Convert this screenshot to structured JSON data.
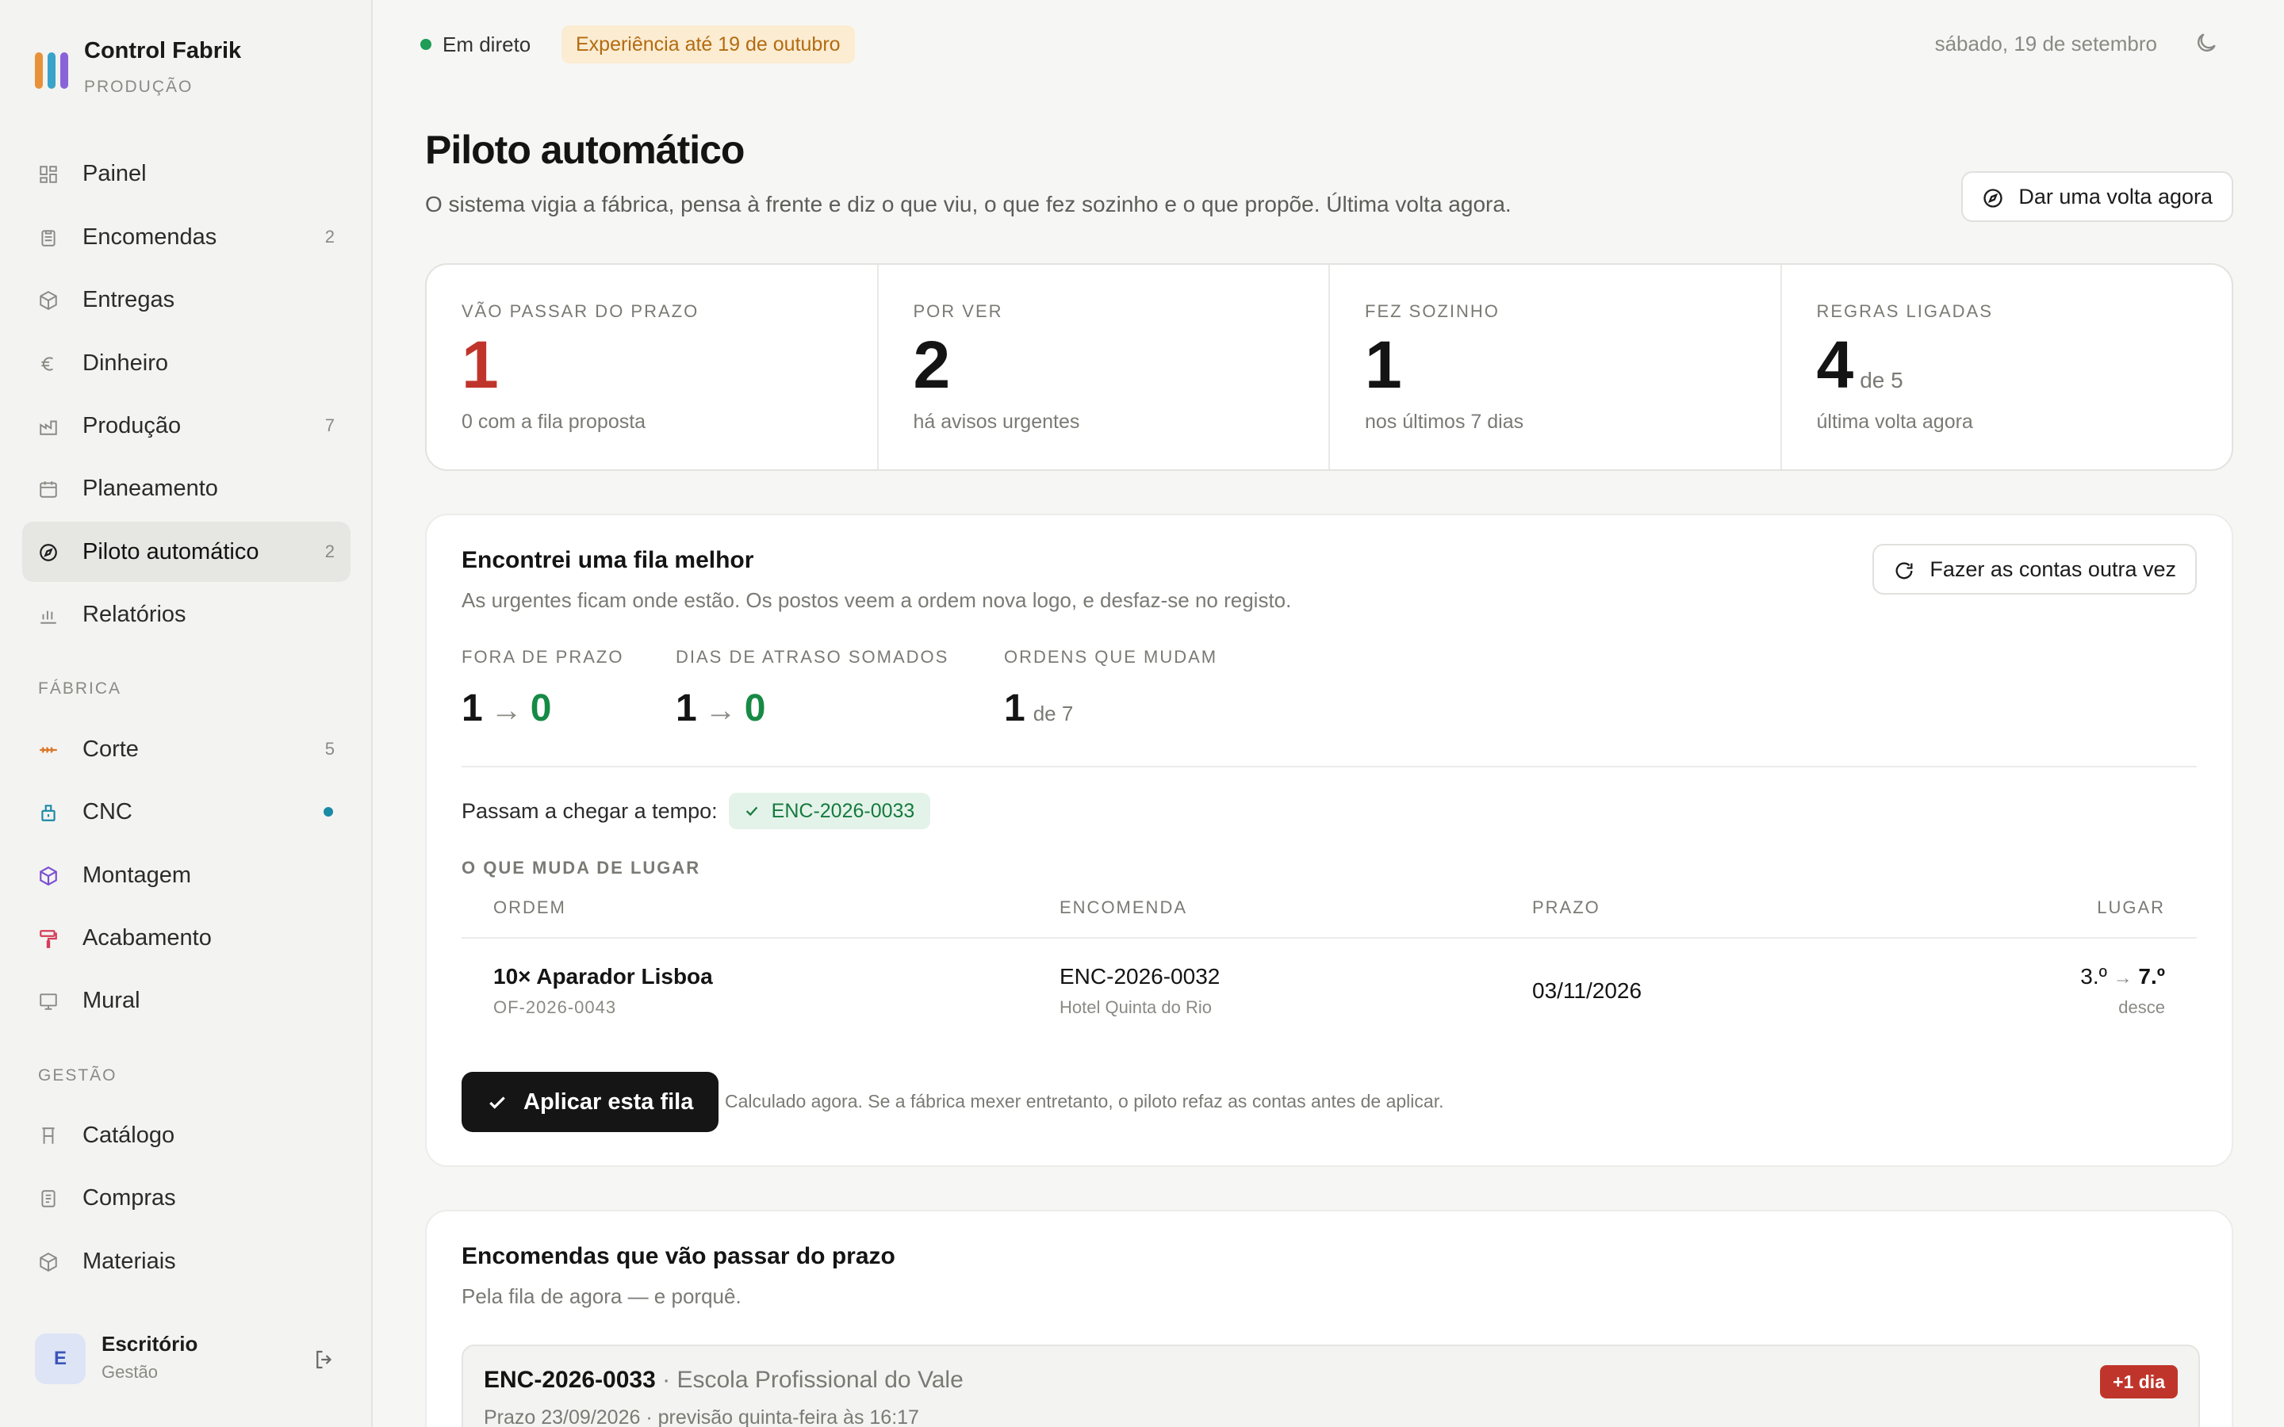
{
  "brand": {
    "name": "Control Fabrik",
    "env": "PRODUÇÃO",
    "colors": [
      "#e8913a",
      "#3aa3c9",
      "#8b63d9"
    ]
  },
  "nav": {
    "main": [
      {
        "label": "Painel",
        "icon": "dashboard-icon",
        "count": ""
      },
      {
        "label": "Encomendas",
        "icon": "clipboard-icon",
        "count": "2"
      },
      {
        "label": "Entregas",
        "icon": "box-icon",
        "count": ""
      },
      {
        "label": "Dinheiro",
        "icon": "euro-icon",
        "count": ""
      },
      {
        "label": "Produção",
        "icon": "factory-icon",
        "count": "7"
      },
      {
        "label": "Planeamento",
        "icon": "calendar-icon",
        "count": ""
      },
      {
        "label": "Piloto automático",
        "icon": "compass-icon",
        "count": "2"
      },
      {
        "label": "Relatórios",
        "icon": "bar-chart-icon",
        "count": ""
      }
    ],
    "factory_label": "FÁBRICA",
    "factory": [
      {
        "label": "Corte",
        "icon": "saw-icon",
        "count": "5"
      },
      {
        "label": "CNC",
        "icon": "cnc-icon",
        "count": ""
      },
      {
        "label": "Montagem",
        "icon": "cube-icon",
        "count": ""
      },
      {
        "label": "Acabamento",
        "icon": "paint-roller-icon",
        "count": ""
      },
      {
        "label": "Mural",
        "icon": "monitor-icon",
        "count": ""
      }
    ],
    "management_label": "GESTÃO",
    "management": [
      {
        "label": "Catálogo",
        "icon": "chair-icon",
        "count": ""
      },
      {
        "label": "Compras",
        "icon": "receipt-icon",
        "count": ""
      },
      {
        "label": "Materiais",
        "icon": "box-icon",
        "count": ""
      }
    ]
  },
  "user": {
    "initial": "E",
    "name": "Escritório",
    "role": "Gestão"
  },
  "topbar": {
    "live": "Em direto",
    "trial": "Experiência até 19 de outubro",
    "date": "sábado, 19 de setembro"
  },
  "page": {
    "title": "Piloto automático",
    "subtitle": "O sistema vigia a fábrica, pensa à frente e diz o que viu, o que fez sozinho e o que propõe. Última volta agora.",
    "run_button": "Dar uma volta agora"
  },
  "stats": [
    {
      "label": "VÃO PASSAR DO PRAZO",
      "value": "1",
      "suffix": "",
      "note": "0 com a fila proposta"
    },
    {
      "label": "POR VER",
      "value": "2",
      "suffix": "",
      "note": "há avisos urgentes"
    },
    {
      "label": "FEZ SOZINHO",
      "value": "1",
      "suffix": "",
      "note": "nos últimos 7 dias"
    },
    {
      "label": "REGRAS LIGADAS",
      "value": "4",
      "suffix": "de 5",
      "note": "última volta agora"
    }
  ],
  "suggestion": {
    "title": "Encontrei uma fila melhor",
    "subtitle": "As urgentes ficam onde estão. Os postos veem a ordem nova logo, e desfaz-se no registo.",
    "recalc_button": "Fazer as contas outra vez",
    "metrics": [
      {
        "label": "FORA DE PRAZO",
        "from": "1",
        "arrow": "→",
        "to": "0"
      },
      {
        "label": "DIAS DE ATRASO SOMADOS",
        "from": "1",
        "arrow": "→",
        "to": "0"
      },
      {
        "label": "ORDENS QUE MUDAM",
        "value": "1",
        "of": "de 7"
      }
    ],
    "ontime_label": "Passam a chegar a tempo:",
    "ontime_orders": [
      "ENC-2026-0033"
    ],
    "table_title": "O QUE MUDA DE LUGAR",
    "columns": [
      "ORDEM",
      "ENCOMENDA",
      "PRAZO",
      "LUGAR"
    ],
    "rows": [
      {
        "order": "10× Aparador Lisboa",
        "order_code": "OF-2026-0043",
        "enc": "ENC-2026-0032",
        "client": "Hotel Quinta do Rio",
        "deadline": "03/11/2026",
        "from": "3.º",
        "arrow": "→",
        "to": "7.º",
        "direction": "desce"
      }
    ],
    "apply_button": "Aplicar esta fila",
    "note": "Calculado agora. Se a fábrica mexer entretanto, o piloto refaz as contas antes de aplicar."
  },
  "late": {
    "title": "Encomendas que vão passar do prazo",
    "subtitle": "Pela fila de agora — e porquê.",
    "items": [
      {
        "code": "ENC-2026-0033",
        "client": "· Escola Profissional do Vale",
        "detail": "Prazo 23/09/2026 · previsão quinta-feira às 16:17",
        "badge": "+1 dia"
      }
    ]
  }
}
